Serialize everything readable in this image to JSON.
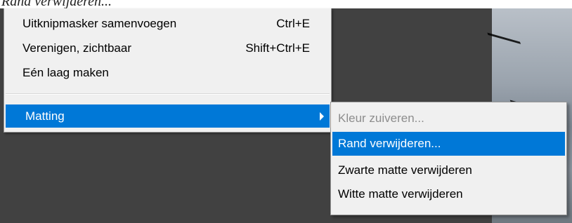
{
  "background": {
    "caption": "Rand verwijderen..."
  },
  "main_menu": {
    "items": [
      {
        "label": "Uitknipmasker samenvoegen",
        "shortcut": "Ctrl+E"
      },
      {
        "label": "Verenigen, zichtbaar",
        "shortcut": "Shift+Ctrl+E"
      },
      {
        "label": "Eén laag maken",
        "shortcut": ""
      },
      {
        "label": "Matting",
        "shortcut": "",
        "has_submenu": true,
        "highlighted": true
      }
    ]
  },
  "submenu": {
    "items": [
      {
        "label": "Kleur zuiveren...",
        "disabled": true
      },
      {
        "label": "Rand verwijderen...",
        "highlighted": true
      },
      {
        "label": "Zwarte matte verwijderen"
      },
      {
        "label": "Witte matte verwijderen"
      }
    ]
  },
  "colors": {
    "highlight": "#0078d7",
    "menu_bg": "#f0f0f0",
    "disabled_text": "#8d8d8d",
    "workspace_bg": "#414141"
  },
  "icons": [
    "submenu-arrow-icon"
  ]
}
